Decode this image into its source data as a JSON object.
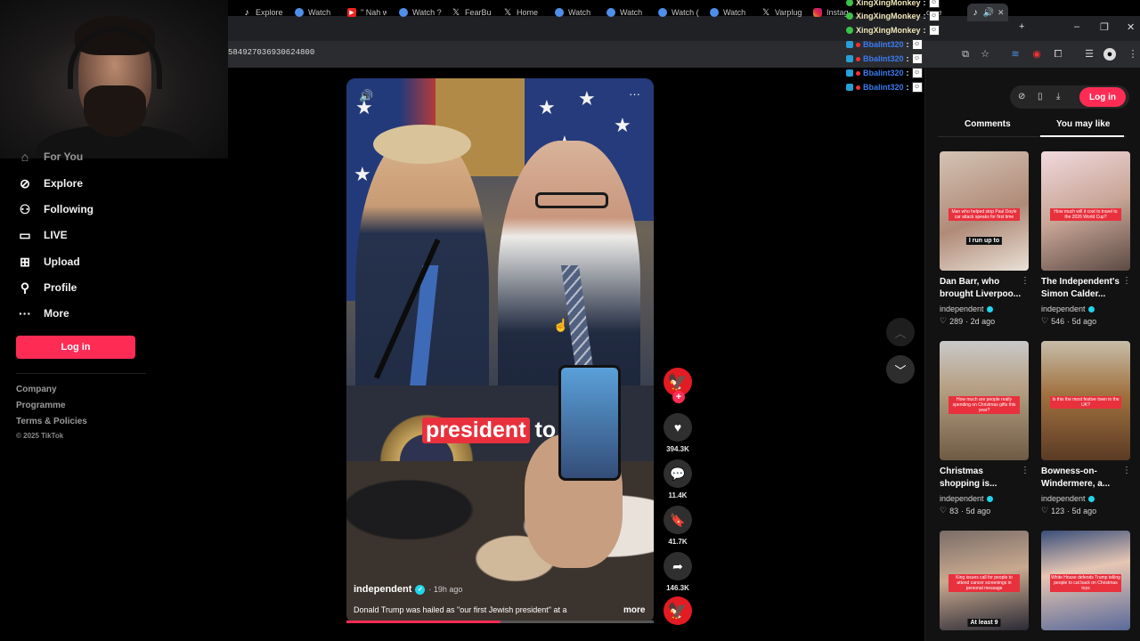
{
  "browser": {
    "tabs": [
      {
        "label": "Explore",
        "icon": "tiktok-icon"
      },
      {
        "label": "Watch",
        "icon": "globe-icon"
      },
      {
        "label": "\" Nah w",
        "icon": "youtube-icon"
      },
      {
        "label": "Watch ?",
        "icon": "globe-icon"
      },
      {
        "label": "FearBu",
        "icon": "x-icon"
      },
      {
        "label": "Home",
        "icon": "x-icon"
      },
      {
        "label": "Watch",
        "icon": "globe-icon"
      },
      {
        "label": "Watch",
        "icon": "globe-icon"
      },
      {
        "label": "Watch (",
        "icon": "globe-icon"
      },
      {
        "label": "Watch",
        "icon": "globe-icon"
      },
      {
        "label": "Varplug",
        "icon": "x-icon"
      },
      {
        "label": "Instag",
        "icon": "instagram-icon"
      },
      {
        "label": "ome",
        "icon": "tiktok-icon"
      }
    ],
    "active_tab_icon": "tiktok-icon",
    "new_tab": "+",
    "window": {
      "minimize": "–",
      "restore": "❐",
      "close": "✕"
    },
    "address": "584927036930624800"
  },
  "chat": [
    {
      "user": "XingXingMonkey",
      "sep": ":",
      "color": "yellow"
    },
    {
      "user": "XingXingMonkey",
      "sep": ":",
      "color": "yellow"
    },
    {
      "user": "XingXingMonkey",
      "sep": ":",
      "color": "yellow"
    },
    {
      "user": "Bbalint320",
      "sep": ":",
      "color": "blue"
    },
    {
      "user": "Bbalint320",
      "sep": ":",
      "color": "blue"
    },
    {
      "user": "Bbalint320",
      "sep": ":",
      "color": "blue"
    },
    {
      "user": "Bbalint320",
      "sep": ":",
      "color": "blue"
    }
  ],
  "sidebar": {
    "partial_item": "For You",
    "items": [
      {
        "label": "Explore",
        "icon": "compass-icon"
      },
      {
        "label": "Following",
        "icon": "following-icon"
      },
      {
        "label": "LIVE",
        "icon": "live-tv-icon"
      },
      {
        "label": "Upload",
        "icon": "upload-plus-icon"
      },
      {
        "label": "Profile",
        "icon": "profile-icon"
      },
      {
        "label": "More",
        "icon": "more-dots-icon"
      }
    ],
    "login_label": "Log in",
    "footer": {
      "company": "Company",
      "programme": "Programme",
      "terms": "Terms & Policies",
      "copyright": "© 2025 TikTok"
    }
  },
  "video": {
    "caption_highlight": "president",
    "caption_rest": "to",
    "author": "independent",
    "posted": "· 19h ago",
    "description": "Donald Trump was hailed as \"our first Jewish president\" at a",
    "more_label": "more",
    "progress": 0.5,
    "brand_color": "#fe2c55"
  },
  "actions": {
    "likes": "394.3K",
    "comments": "11.4K",
    "saves": "41.7K",
    "shares": "146.3K"
  },
  "right_panel": {
    "login_label": "Log in",
    "tabs": [
      "Comments",
      "You may like"
    ],
    "active_tab": "You may like",
    "cards": [
      {
        "title1": "Dan Barr, who",
        "title2": "brought Liverpoo...",
        "author": "independent",
        "likes": "289",
        "age": "· 2d ago",
        "thumb_caption": "Man who helped stop Paul Doyle car attack speaks for first time",
        "thumb_sub": "I run up to"
      },
      {
        "title1": "The Independent's",
        "title2": "Simon Calder...",
        "author": "independent",
        "likes": "546",
        "age": "· 5d ago",
        "thumb_caption": "How much will it cost to travel to the 2026 World Cup?",
        "thumb_sub": ""
      },
      {
        "title1": "Christmas",
        "title2": "shopping is...",
        "author": "independent",
        "likes": "83",
        "age": "· 5d ago",
        "thumb_caption": "How much are people really spending on Christmas gifts this year?",
        "thumb_sub": ""
      },
      {
        "title1": "Bowness-on-",
        "title2": "Windermere, a...",
        "author": "independent",
        "likes": "123",
        "age": "· 5d ago",
        "thumb_caption": "Is this the most festive town in the UK?",
        "thumb_sub": ""
      },
      {
        "title1": "",
        "title2": "",
        "author": "",
        "likes": "",
        "age": "",
        "thumb_caption": "King issues call for people to attend cancer screenings in personal message",
        "thumb_sub": "At least 9"
      },
      {
        "title1": "",
        "title2": "",
        "author": "",
        "likes": "",
        "age": "",
        "thumb_caption": "White House defends Trump telling people to cut back on Christmas toys",
        "thumb_sub": ""
      }
    ]
  }
}
